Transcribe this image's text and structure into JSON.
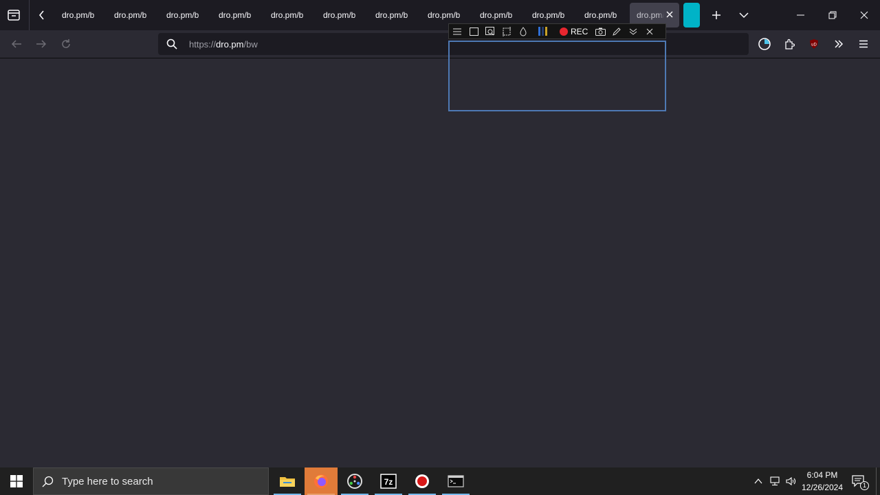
{
  "tabs": {
    "list": [
      {
        "title": "dro.pm/b"
      },
      {
        "title": "dro.pm/b"
      },
      {
        "title": "dro.pm/b"
      },
      {
        "title": "dro.pm/b"
      },
      {
        "title": "dro.pm/b"
      },
      {
        "title": "dro.pm/b"
      },
      {
        "title": "dro.pm/b"
      },
      {
        "title": "dro.pm/b"
      },
      {
        "title": "dro.pm/b"
      },
      {
        "title": "dro.pm/b"
      },
      {
        "title": "dro.pm/b"
      }
    ],
    "active_index": 11,
    "active_title": "dro.pm/b"
  },
  "navbar": {
    "url_prefix": "https://",
    "url_domain": "dro.pm",
    "url_path": "/bw"
  },
  "capture_toolbar": {
    "rec_label": "REC",
    "chip_colors": [
      "#2f6fd6",
      "#233a6e",
      "#c9a227"
    ]
  },
  "taskbar": {
    "search_placeholder": "Type here to search",
    "apps": [
      "file-explorer",
      "firefox",
      "davinci-resolve",
      "7zip",
      "obs-recorder",
      "terminal"
    ],
    "clock_time": "6:04 PM",
    "clock_date": "12/26/2024",
    "notification_count": "1"
  },
  "colors": {
    "accent_teal": "#00b3c7",
    "selection_border": "#4e79b4",
    "rec_red": "#e8262f"
  }
}
